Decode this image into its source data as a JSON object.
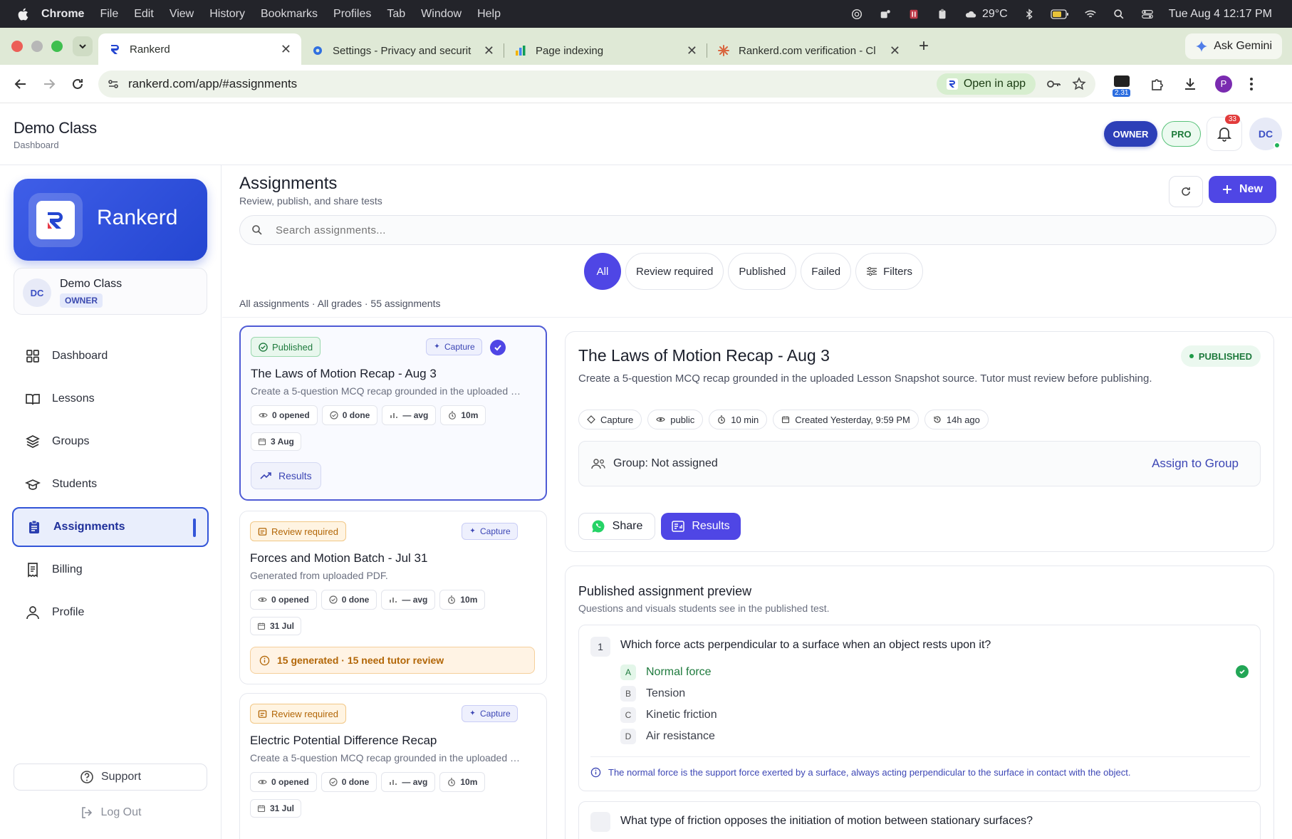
{
  "menubar": {
    "app": "Chrome",
    "items": [
      "File",
      "Edit",
      "View",
      "History",
      "Bookmarks",
      "Profiles",
      "Tab",
      "Window",
      "Help"
    ],
    "weather": "29°C",
    "clock": "Tue Aug 4  12:17 PM"
  },
  "tabs": [
    {
      "title": "Rankerd",
      "active": true
    },
    {
      "title": "Settings - Privacy and securit",
      "active": false
    },
    {
      "title": "Page indexing",
      "active": false
    },
    {
      "title": "Rankerd.com verification - Cl",
      "active": false
    }
  ],
  "gemini_label": "Ask Gemini",
  "address": {
    "url": "rankerd.com/app/#assignments",
    "open_in_app": "Open in app",
    "ext_badge": "2.31",
    "profile_initial": "P"
  },
  "header": {
    "title": "Demo Class",
    "subtitle": "Dashboard",
    "owner_pill": "OWNER",
    "pro_pill": "PRO",
    "notif_count": "33",
    "avatar": "DC"
  },
  "sidebar": {
    "brand": "Rankerd",
    "class_avatar": "DC",
    "class_name": "Demo Class",
    "class_role": "OWNER",
    "items": [
      {
        "label": "Dashboard",
        "icon": "grid-icon"
      },
      {
        "label": "Lessons",
        "icon": "book-icon"
      },
      {
        "label": "Groups",
        "icon": "layers-icon"
      },
      {
        "label": "Students",
        "icon": "graduation-cap-icon"
      },
      {
        "label": "Assignments",
        "icon": "clipboard-icon",
        "active": true
      },
      {
        "label": "Billing",
        "icon": "receipt-icon"
      },
      {
        "label": "Profile",
        "icon": "user-icon"
      }
    ],
    "support": "Support",
    "logout": "Log Out"
  },
  "main": {
    "title": "Assignments",
    "subtitle": "Review, publish, and share tests",
    "new_label": "New",
    "search_placeholder": "Search assignments...",
    "filters": [
      "All",
      "Review required",
      "Published",
      "Failed",
      "Filters"
    ],
    "summary": "All assignments · All grades · 55 assignments"
  },
  "cards": [
    {
      "status": "Published",
      "source": "Capture",
      "title": "The Laws of Motion Recap - Aug 3",
      "desc": "Create a 5-question MCQ recap grounded in the uploaded …",
      "stats": [
        "0 opened",
        "0 done",
        "— avg",
        "10m"
      ],
      "date": "3 Aug",
      "action": "Results"
    },
    {
      "status": "Review required",
      "source": "Capture",
      "title": "Forces and Motion Batch - Jul 31",
      "desc": "Generated from uploaded PDF.",
      "stats": [
        "0 opened",
        "0 done",
        "— avg",
        "10m"
      ],
      "date": "31 Jul",
      "warning": "15 generated · 15 need tutor review"
    },
    {
      "status": "Review required",
      "source": "Capture",
      "title": "Electric Potential Difference Recap",
      "desc": "Create a 5-question MCQ recap grounded in the uploaded …",
      "stats": [
        "0 opened",
        "0 done",
        "— avg",
        "10m"
      ],
      "date": "31 Jul"
    }
  ],
  "detail": {
    "title": "The Laws of Motion Recap - Aug 3",
    "status": "PUBLISHED",
    "description": "Create a 5-question MCQ recap grounded in the uploaded Lesson Snapshot source. Tutor must review before publishing.",
    "meta": [
      "Capture",
      "public",
      "10 min",
      "Created Yesterday, 9:59 PM",
      "14h ago"
    ],
    "group_label": "Group: Not assigned",
    "assign_label": "Assign to Group",
    "share_label": "Share",
    "results_label": "Results"
  },
  "preview": {
    "title": "Published assignment preview",
    "subtitle": "Questions and visuals students see in the published test.",
    "q1": {
      "num": "1",
      "text": "Which force acts perpendicular to a surface when an object rests upon it?",
      "options": [
        {
          "letter": "A",
          "text": "Normal force",
          "correct": true
        },
        {
          "letter": "B",
          "text": "Tension"
        },
        {
          "letter": "C",
          "text": "Kinetic friction"
        },
        {
          "letter": "D",
          "text": "Air resistance"
        }
      ],
      "explanation": "The normal force is the support force exerted by a surface, always acting perpendicular to the surface in contact with the object."
    },
    "q2_text": "What type of friction opposes the initiation of motion between stationary surfaces?"
  },
  "colors": {
    "accent": "#4f46e5",
    "brand": "#2d4ad6",
    "published": "#1e7a3d",
    "review": "#b26607"
  }
}
